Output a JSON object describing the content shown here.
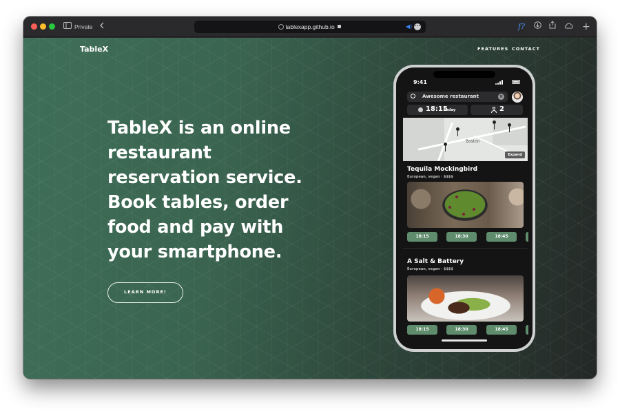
{
  "browser": {
    "mode_label": "Private",
    "url": "tablexapp.github.io",
    "reader_icon": "f?"
  },
  "site": {
    "logo": "TableX",
    "nav": [
      "FEATURES",
      "CONTACT"
    ],
    "headline": "TableX is an online restaurant reservation service. Book tables, order food and pay with your smartphone.",
    "cta": "LEARN MORE!"
  },
  "phone": {
    "time": "9:41",
    "search_value": "Awesome restaurant",
    "booking_time": "18:15",
    "booking_day": "today",
    "party_size": "2",
    "map_label": "Boston",
    "map_button": "Expand",
    "restaurants": [
      {
        "name": "Tequila Mockingbird",
        "details": "European, vegan · $$$$",
        "slots": [
          "18:15",
          "18:30",
          "18:45"
        ]
      },
      {
        "name": "A Salt & Battery",
        "details": "European, vegan · $$$$",
        "slots": [
          "18:15",
          "18:30",
          "18:45"
        ]
      }
    ]
  },
  "colors": {
    "accent_green": "#5f8c6d",
    "page_green": "#3f6f58",
    "dark": "#242826"
  }
}
